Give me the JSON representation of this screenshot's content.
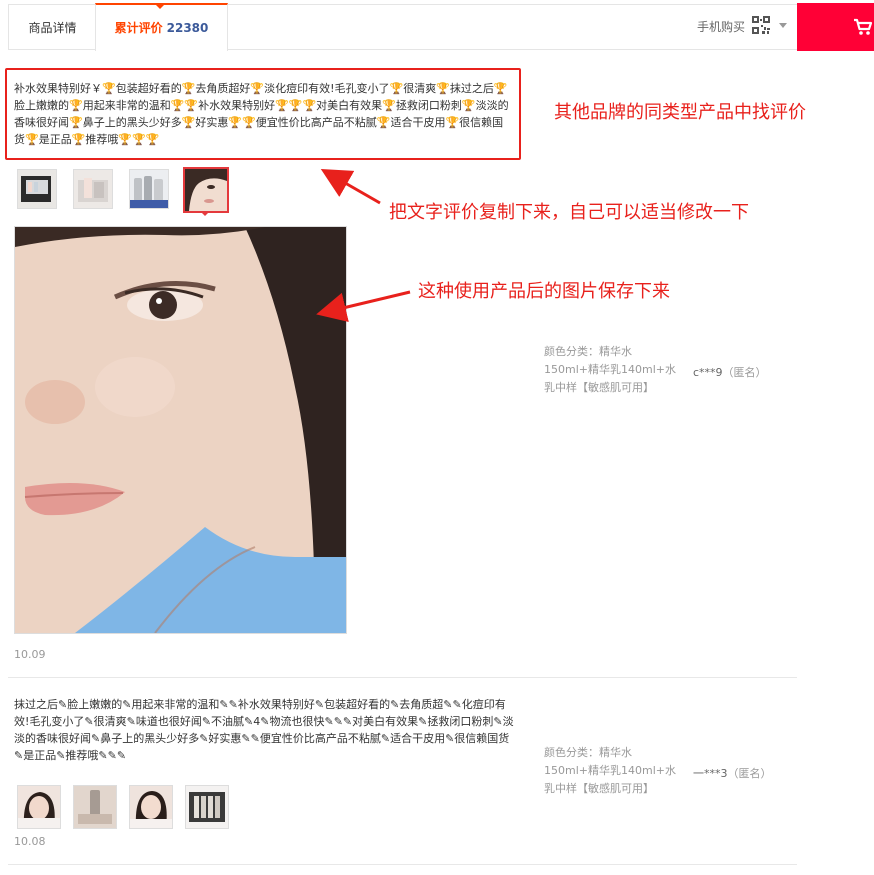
{
  "tabs": {
    "detail_label": "商品详情",
    "reviews_label": "累计评价",
    "reviews_count": "22380",
    "mobile_buy_label": "手机购买"
  },
  "reviews": [
    {
      "text": "补水效果特别好￥🏆包装超好看的🏆去角质超好🏆淡化痘印有效!毛孔变小了🏆很清爽🏆抹过之后🏆脸上嫩嫩的🏆用起来非常的温和🏆🏆补水效果特别好🏆🏆🏆对美白有效果🏆拯救闭口粉刺🏆淡淡的香味很好闻🏆鼻子上的黑头少好多🏆好实惠🏆🏆便宜性价比高产品不粘腻🏆适合干皮用🏆很信赖国货🏆是正品🏆推荐哦🏆🏆🏆",
      "date": "10.09",
      "sku": "颜色分类：精华水150ml+精华乳140ml+水乳中样【敏感肌可用】",
      "author": "c***9",
      "anon": "（匿名）"
    },
    {
      "text": "抹过之后✎脸上嫩嫩的✎用起来非常的温和✎✎补水效果特别好✎包装超好看的✎去角质超✎✎化痘印有效!毛孔变小了✎很清爽✎味道也很好闻✎不油腻✎4✎物流也很快✎✎✎对美白有效果✎拯救闭口粉刺✎淡淡的香味很好闻✎鼻子上的黑头少好多✎好实惠✎✎便宜性价比高产品不粘腻✎适合干皮用✎很信赖国货✎是正品✎推荐哦✎✎✎",
      "date": "10.08",
      "sku": "颜色分类：精华水150ml+精华乳140ml+水乳中样【敏感肌可用】",
      "author": "一***3",
      "anon": "（匿名）"
    }
  ],
  "annotations": {
    "a1": "其他品牌的同类型产品中找评价",
    "a2": "把文字评价复制下来，自己可以适当修改一下",
    "a3": "这种使用产品后的图片保存下来"
  },
  "colors": {
    "accent": "#ff0036",
    "tab_active": "#ff4400",
    "annotation": "#e8211c"
  }
}
